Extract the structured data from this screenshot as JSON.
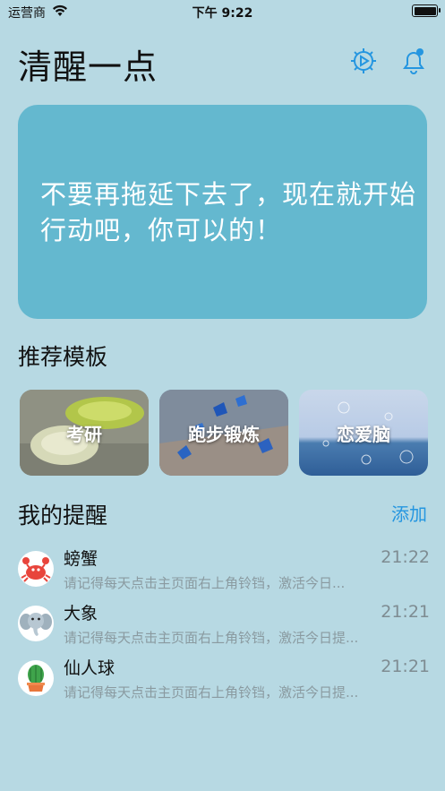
{
  "status_bar": {
    "carrier": "运营商",
    "time": "下午 9:22"
  },
  "header": {
    "title": "清醒一点"
  },
  "hero": {
    "text": "不要再拖延下去了，现在就开始行动吧，你可以的！"
  },
  "templates": {
    "title": "推荐模板",
    "items": [
      {
        "label": "考研"
      },
      {
        "label": "跑步锻炼"
      },
      {
        "label": "恋爱脑"
      }
    ]
  },
  "reminders": {
    "title": "我的提醒",
    "add_label": "添加",
    "items": [
      {
        "name": "螃蟹",
        "desc": "请记得每天点击主页面右上角铃铛，激活今日...",
        "time": "21:22",
        "icon": "crab-icon"
      },
      {
        "name": "大象",
        "desc": "请记得每天点击主页面右上角铃铛，激活今日提...",
        "time": "21:21",
        "icon": "elephant-icon"
      },
      {
        "name": "仙人球",
        "desc": "请记得每天点击主页面右上角铃铛，激活今日提...",
        "time": "21:21",
        "icon": "cactus-icon"
      }
    ]
  },
  "colors": {
    "accent": "#2596e0",
    "background": "#b7d9e3",
    "hero": "#64b8cf"
  }
}
